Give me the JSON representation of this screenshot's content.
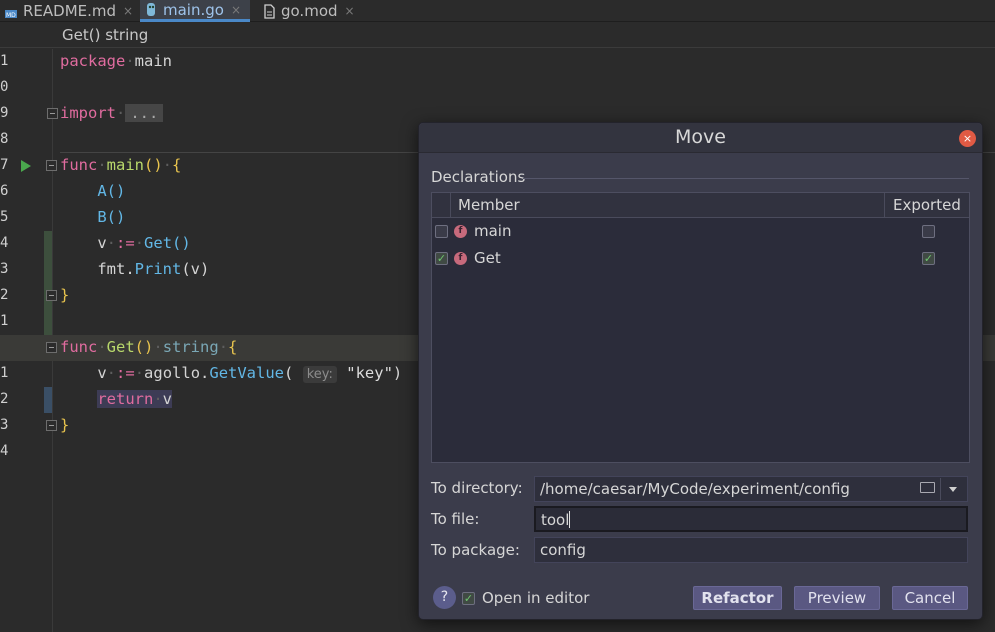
{
  "tabs": [
    {
      "label": "README.md",
      "icon": "markdown-file-icon",
      "active": false
    },
    {
      "label": "main.go",
      "icon": "go-file-icon",
      "active": true
    },
    {
      "label": "go.mod",
      "icon": "file-icon",
      "active": false
    }
  ],
  "tab_close_glyph": "×",
  "breadcrumb": "Get() string",
  "editor": {
    "line_numbers": [
      "1",
      "0",
      "9",
      "8",
      "7",
      "6",
      "5",
      "4",
      "3",
      "2",
      "1",
      "",
      "1",
      "2",
      "3",
      "4"
    ],
    "code": {
      "pkg_kw": "package",
      "pkg_name": "main",
      "import_kw": "import",
      "import_fold": "...",
      "func_kw": "func",
      "main_name": "main",
      "main_sig": "()",
      "open_brace": "{",
      "close_brace": "}",
      "a_call": "A()",
      "b_call": "B()",
      "v_var": "v",
      "assign": ":=",
      "get_call": "Get()",
      "fmt": "fmt.",
      "print": "Print",
      "print_args": "(v)",
      "get_name": "Get",
      "get_sig": "()",
      "string_type": "string",
      "agollo": "agollo.",
      "getvalue": "GetValue",
      "paren_open": "(",
      "hint_key": "key:",
      "key_str": "\"key\"",
      "paren_close": ")",
      "return_kw": "return",
      "return_val": "v"
    }
  },
  "dialog": {
    "title": "Move",
    "close_glyph": "×",
    "declarations_label": "Declarations",
    "columns": {
      "member": "Member",
      "exported": "Exported"
    },
    "rows": [
      {
        "name": "main",
        "checked": false,
        "exported": false,
        "icon_letter": "f"
      },
      {
        "name": "Get",
        "checked": true,
        "exported": true,
        "icon_letter": "f"
      }
    ],
    "to_directory_label": "To directory:",
    "to_directory_value": "/home/caesar/MyCode/experiment/config",
    "to_file_label": "To file:",
    "to_file_value": "tool",
    "to_package_label": "To package:",
    "to_package_value": "config",
    "help_glyph": "?",
    "open_in_editor_label": "Open in editor",
    "open_in_editor_checked": true,
    "check_glyph": "✓",
    "buttons": {
      "refactor": "Refactor",
      "preview": "Preview",
      "cancel": "Cancel"
    }
  }
}
